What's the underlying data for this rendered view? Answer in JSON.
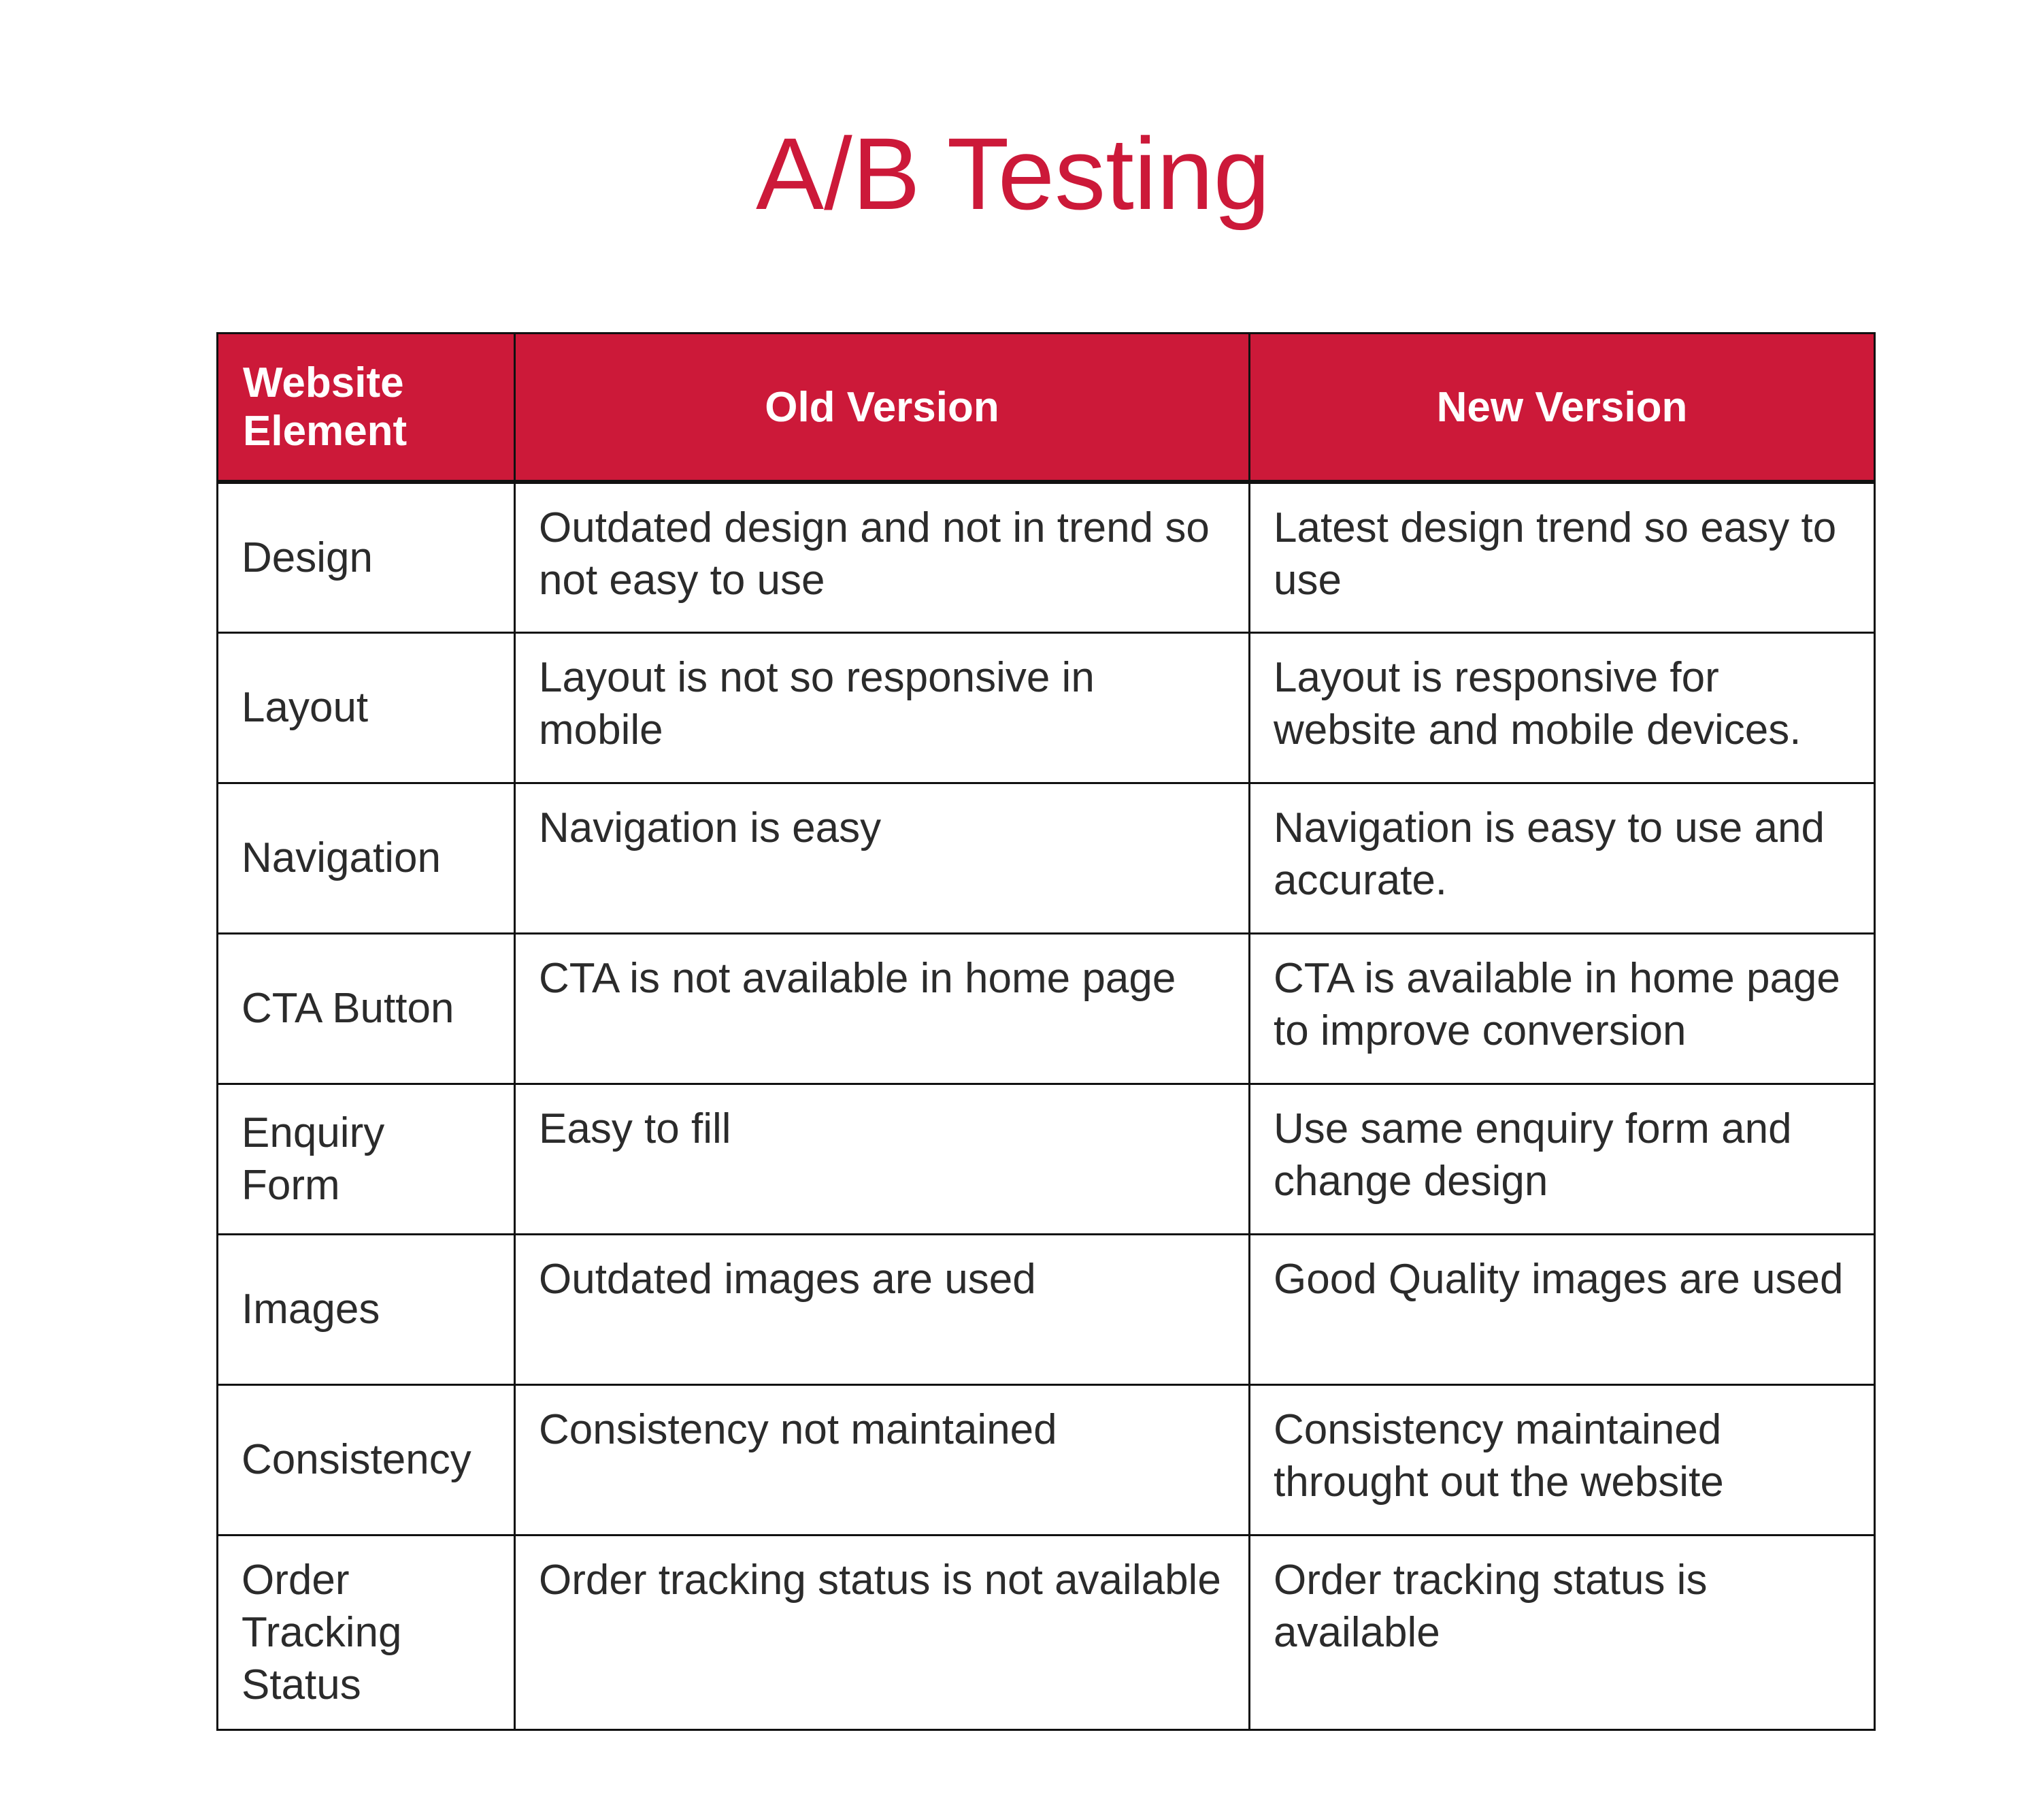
{
  "title": "A/B Testing",
  "colors": {
    "accent": "#cc1939",
    "text": "#2b2b2b"
  },
  "table": {
    "headers": [
      "Website Element",
      "Old Version",
      "New Version"
    ],
    "rows": [
      [
        "Design",
        "Outdated design and not in trend so not easy to use",
        "Latest design trend so easy to use"
      ],
      [
        "Layout",
        "Layout is not so responsive in mobile",
        "Layout is responsive for website and mobile devices."
      ],
      [
        "Navigation",
        "Navigation is easy",
        "Navigation is easy to use and accurate."
      ],
      [
        "CTA Button",
        "CTA is not available in home page",
        "CTA is available in home page to improve conversion"
      ],
      [
        "Enquiry Form",
        "Easy to fill",
        "Use same enquiry form and change design"
      ],
      [
        "Images",
        "Outdated images are used",
        "Good Quality images are used"
      ],
      [
        "Consistency",
        "Consistency not maintained",
        "Consistency maintained throught out the website"
      ],
      [
        "Order Tracking Status",
        "Order tracking status is not available",
        "Order tracking status is available"
      ]
    ]
  }
}
